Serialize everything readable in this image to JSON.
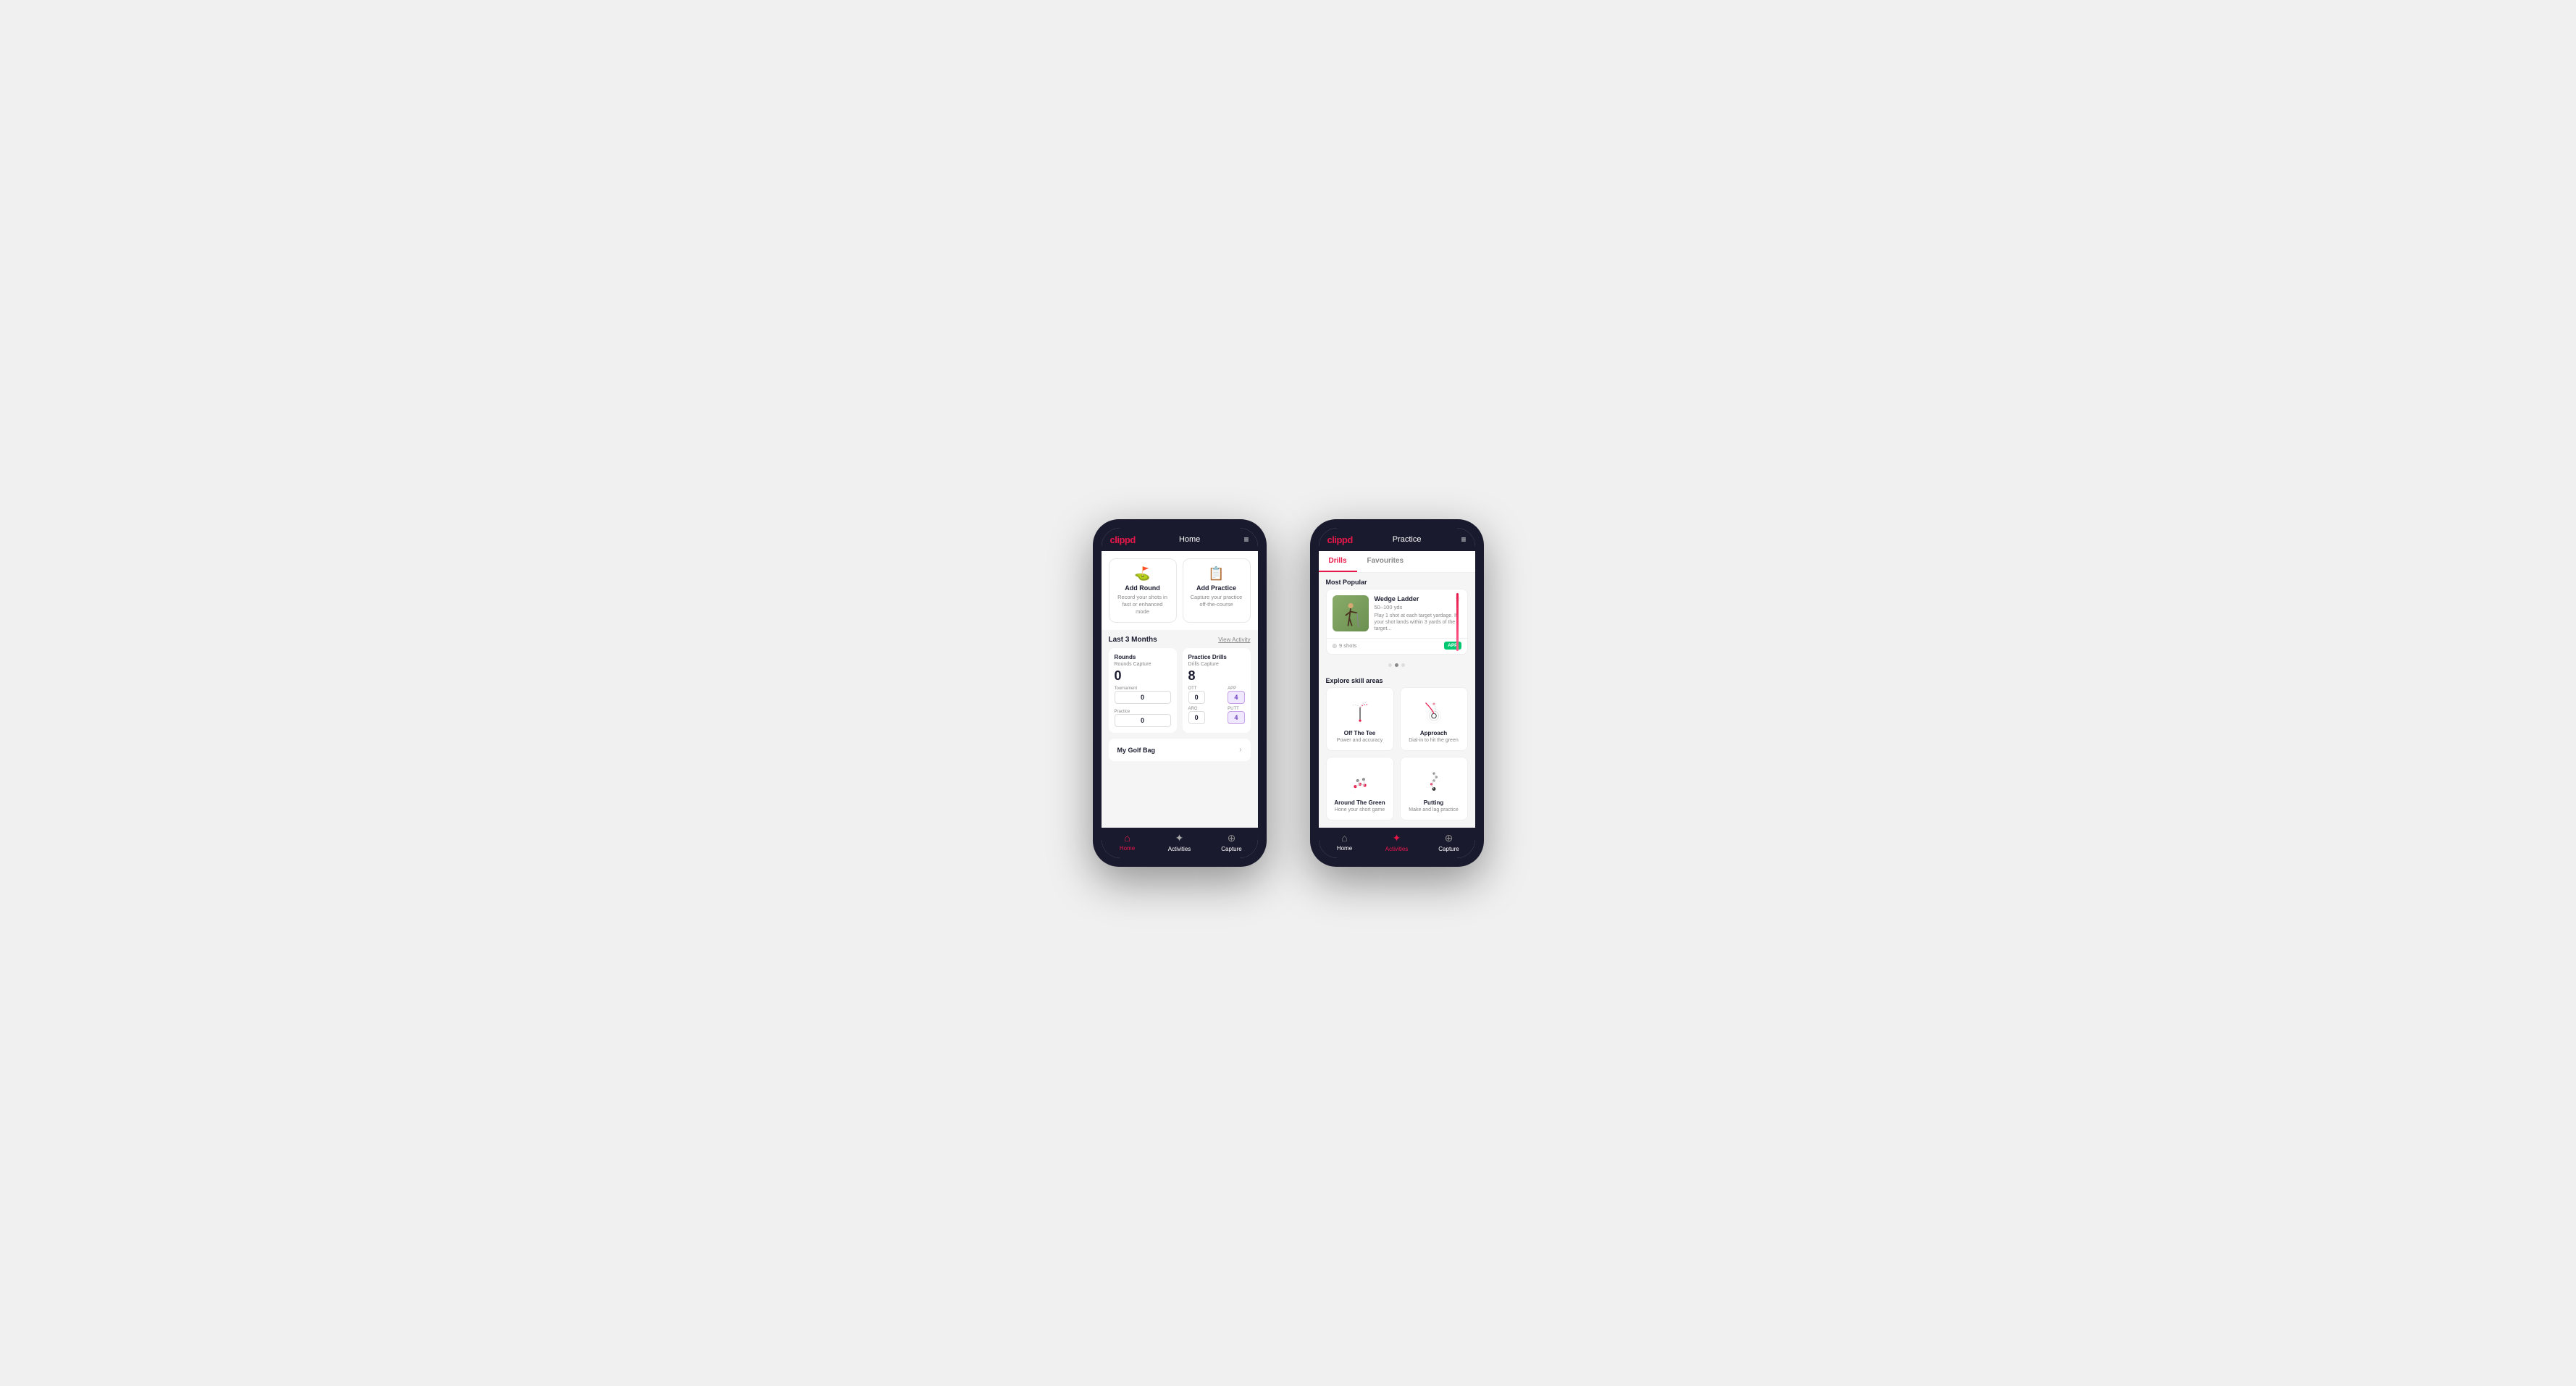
{
  "phone1": {
    "header": {
      "logo": "clippd",
      "title": "Home",
      "menu_icon": "≡"
    },
    "action_cards": [
      {
        "id": "add-round",
        "icon": "⛳",
        "title": "Add Round",
        "desc": "Record your shots in fast or enhanced mode"
      },
      {
        "id": "add-practice",
        "icon": "📋",
        "title": "Add Practice",
        "desc": "Capture your practice off-the-course"
      }
    ],
    "activity_section": {
      "title": "Last 3 Months",
      "link": "View Activity"
    },
    "rounds": {
      "title": "Rounds",
      "capture_label": "Rounds Capture",
      "big_number": "0",
      "tournament_label": "Tournament",
      "tournament_value": "0",
      "practice_label": "Practice",
      "practice_value": "0"
    },
    "practice_drills": {
      "title": "Practice Drills",
      "capture_label": "Drills Capture",
      "big_number": "8",
      "ott_label": "OTT",
      "ott_value": "0",
      "app_label": "APP",
      "app_value": "4",
      "arg_label": "ARG",
      "arg_value": "0",
      "putt_label": "PUTT",
      "putt_value": "4"
    },
    "golf_bag": {
      "label": "My Golf Bag"
    },
    "nav": {
      "home": "Home",
      "activities": "Activities",
      "capture": "Capture"
    }
  },
  "phone2": {
    "header": {
      "logo": "clippd",
      "title": "Practice",
      "menu_icon": "≡"
    },
    "tabs": [
      {
        "label": "Drills",
        "active": true
      },
      {
        "label": "Favourites",
        "active": false
      }
    ],
    "most_popular": {
      "title": "Most Popular"
    },
    "featured_drill": {
      "title": "Wedge Ladder",
      "subtitle": "50–100 yds",
      "desc": "Play 1 shot at each target yardage. If your shot lands within 3 yards of the target...",
      "shots": "9 shots",
      "badge": "APP"
    },
    "explore": {
      "title": "Explore skill areas",
      "skills": [
        {
          "id": "off-the-tee",
          "title": "Off The Tee",
          "desc": "Power and accuracy"
        },
        {
          "id": "approach",
          "title": "Approach",
          "desc": "Dial-in to hit the green"
        },
        {
          "id": "around-the-green",
          "title": "Around The Green",
          "desc": "Hone your short game"
        },
        {
          "id": "putting",
          "title": "Putting",
          "desc": "Make and lag practice"
        }
      ]
    },
    "nav": {
      "home": "Home",
      "activities": "Activities",
      "capture": "Capture"
    },
    "dots": [
      1,
      2,
      3
    ],
    "active_dot": 1
  }
}
